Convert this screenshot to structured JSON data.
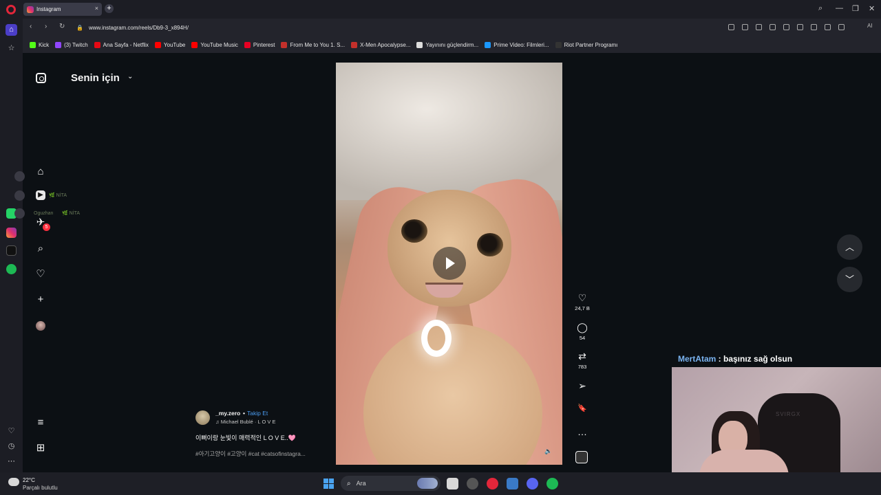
{
  "browser": {
    "tab_title": "Instagram",
    "tab_close": "×",
    "new_tab": "+",
    "url": "www.instagram.com/reels/Db9-3_x894H/",
    "window_controls": [
      "⌕",
      "—",
      "❐",
      "✕"
    ],
    "nav": {
      "back": "‹",
      "forward": "›",
      "reload": "↻",
      "lock": "🔒"
    },
    "aria_label": "AI"
  },
  "bookmarks": [
    {
      "label": "Kick",
      "color": "#53fc18"
    },
    {
      "label": "(3) Twitch",
      "color": "#9146ff"
    },
    {
      "label": "Ana Sayfa - Netflix",
      "color": "#e50914"
    },
    {
      "label": "YouTube",
      "color": "#ff0000"
    },
    {
      "label": "YouTube Music",
      "color": "#ff0000"
    },
    {
      "label": "Pinterest",
      "color": "#e60023"
    },
    {
      "label": "From Me to You 1. S...",
      "color": "#c4302b"
    },
    {
      "label": "X-Men Apocalypse...",
      "color": "#c4302b"
    },
    {
      "label": "Yayınını güçlendirm...",
      "color": "#dddddd"
    },
    {
      "label": "Prime Video: Filmleri...",
      "color": "#1a98ff"
    },
    {
      "label": "Riot Partner Programı",
      "color": "#333333"
    }
  ],
  "instagram": {
    "feed_title": "Senin için",
    "feed_chevron": "⌄",
    "nav_icons": {
      "home": "⌂",
      "reels": "▶",
      "messages": "✈",
      "search": "⌕",
      "notifications": "♡",
      "create": "+",
      "menu": "≡",
      "more": "⊞"
    },
    "message_badge": "5",
    "ghost_notifications": [
      {
        "user": "",
        "tag": "🌿 NİTA"
      },
      {
        "user": "Oguzhan",
        "tag": "🌿 NİTA"
      }
    ],
    "post": {
      "author": "_my.zero",
      "separator": "•",
      "follow_label": "Takip Et",
      "music": "♫ Michael Bublé · L O V E",
      "caption": "이뻐이랑 눈빛이 매력적인 L O V E..🩷",
      "hashtags": "#아기고양이 #고양이 #cat #catsofinstagra..."
    },
    "actions": {
      "likes": "24,7 B",
      "comments": "54",
      "reposts": "783",
      "like_icon": "♡",
      "comment_icon": "◯",
      "repost_icon": "⇄",
      "share_icon": "➢",
      "save_icon": "🔖",
      "more_icon": "…"
    },
    "mute_icon": "🔈",
    "scroll": {
      "up": "︿",
      "down": "﹀"
    }
  },
  "stream": {
    "chat_user": "MertAtam",
    "chat_message": " : başınız sağ olsun",
    "chair_brand": "SVIRGX"
  },
  "taskbar": {
    "temperature": "22°C",
    "condition": "Parçalı bulutlu",
    "search_placeholder": "Ara",
    "search_icon": "⌕"
  },
  "colors": {
    "accent_purple": "#4b3ec7",
    "follow_blue": "#4a9cf0",
    "badge_red": "#ff3040",
    "chat_user": "#7ab3f0"
  }
}
